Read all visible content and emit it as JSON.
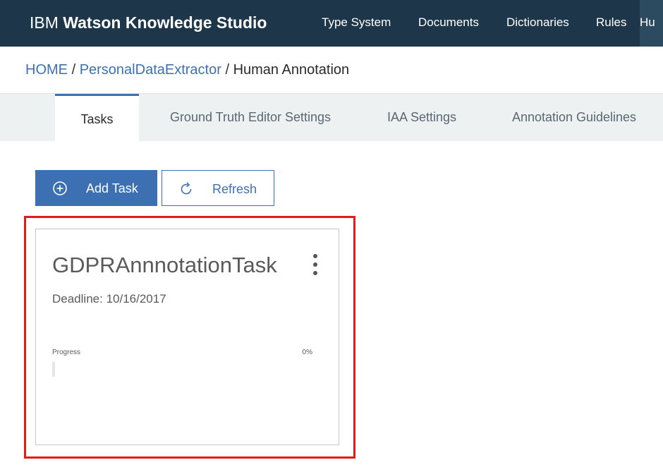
{
  "header": {
    "brand_ibm": "IBM",
    "brand_product": "Watson Knowledge Studio",
    "nav": [
      {
        "label": "Type System"
      },
      {
        "label": "Documents"
      },
      {
        "label": "Dictionaries"
      },
      {
        "label": "Rules"
      },
      {
        "label": "Hu"
      }
    ]
  },
  "breadcrumb": {
    "home": "HOME",
    "sep1": "/",
    "project": "PersonalDataExtractor",
    "sep2": "/",
    "current": "Human Annotation"
  },
  "tabs": [
    {
      "label": "Tasks",
      "active": true
    },
    {
      "label": "Ground Truth Editor Settings"
    },
    {
      "label": "IAA Settings"
    },
    {
      "label": "Annotation Guidelines"
    }
  ],
  "toolbar": {
    "add_task_label": "Add Task",
    "add_task_icon": "plus-circle-icon",
    "refresh_label": "Refresh",
    "refresh_icon": "refresh-icon"
  },
  "task_card": {
    "title": "GDPRAnnnotationTask",
    "deadline_label": "Deadline:",
    "deadline_value": "10/16/2017",
    "progress_label": "Progress",
    "progress_text": "0%",
    "progress_fraction": 0.0,
    "menu_icon": "overflow-menu-icon"
  },
  "colors": {
    "header_bg": "#1d3649",
    "accent": "#3d70b2",
    "highlight_border": "#e31b1b",
    "tabs_bg": "#eef1f2"
  }
}
